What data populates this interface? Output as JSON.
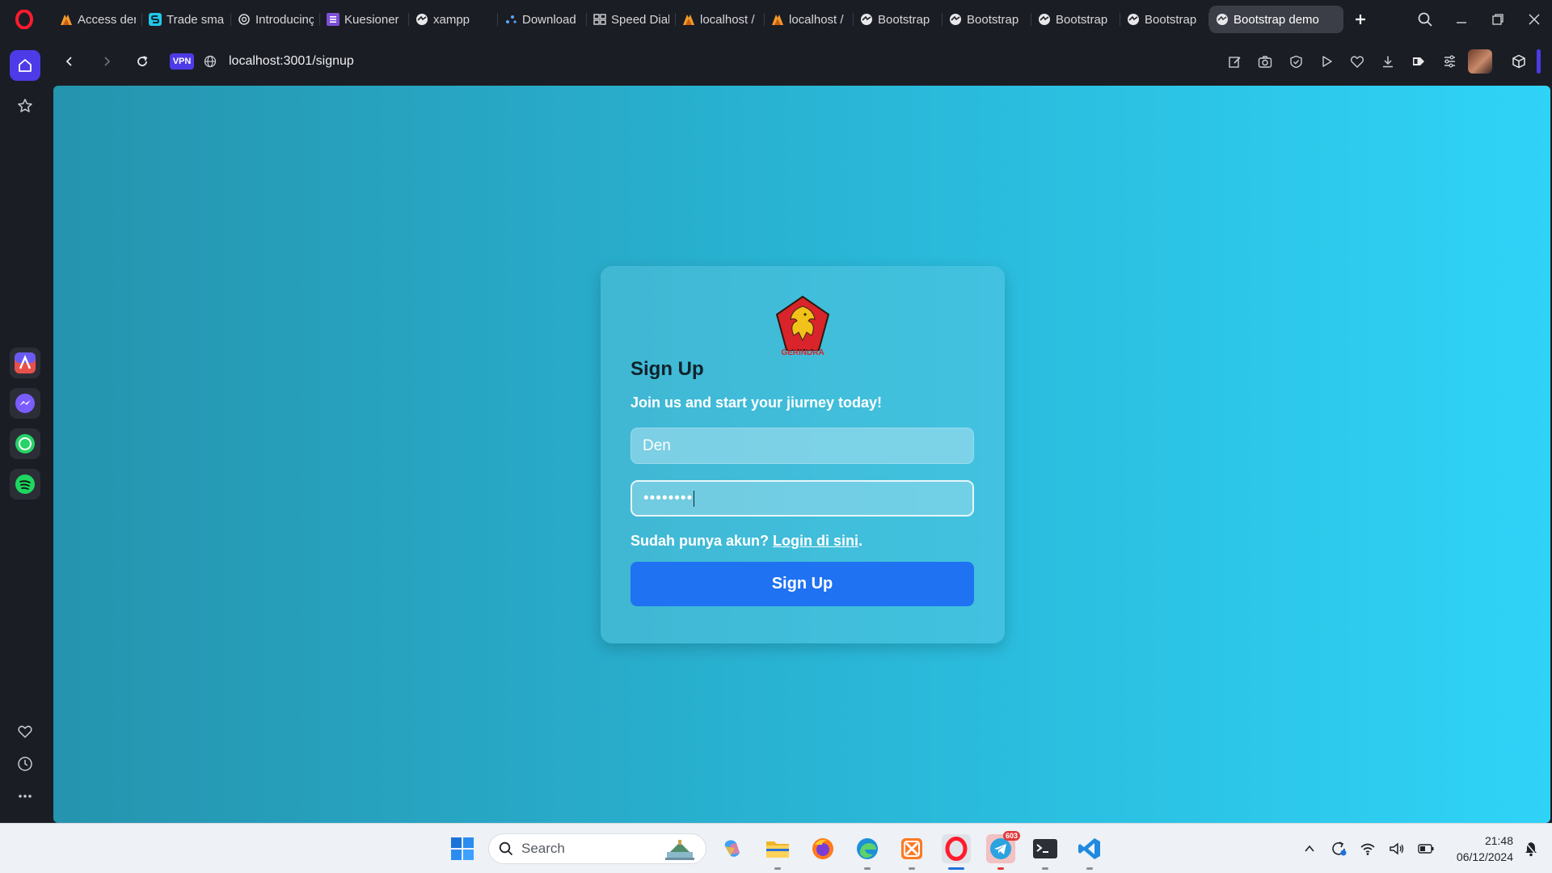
{
  "browser": {
    "tabs": [
      {
        "title": "Access den",
        "icon": "xampp-icon"
      },
      {
        "title": "Trade smar",
        "icon": "swap-app-icon"
      },
      {
        "title": "Introducinç",
        "icon": "openai-icon"
      },
      {
        "title": "Kuesioner",
        "icon": "forms-icon"
      },
      {
        "title": "xampp",
        "icon": "globe-icon"
      },
      {
        "title": "Download",
        "icon": "download-icon"
      },
      {
        "title": "Speed Dial",
        "icon": "speed-dial-icon"
      },
      {
        "title": "localhost /",
        "icon": "phpmyadmin-icon"
      },
      {
        "title": "localhost /",
        "icon": "phpmyadmin-icon"
      },
      {
        "title": "Bootstrap",
        "icon": "globe-icon"
      },
      {
        "title": "Bootstrap",
        "icon": "globe-icon"
      },
      {
        "title": "Bootstrap",
        "icon": "globe-icon"
      },
      {
        "title": "Bootstrap",
        "icon": "globe-icon"
      },
      {
        "title": "Bootstrap demo",
        "icon": "globe-icon",
        "active": true
      }
    ],
    "vpn_label": "VPN",
    "url": "localhost:3001/signup",
    "accent": "#4d3be8"
  },
  "page": {
    "logo_text": "GERINDRA",
    "title": "Sign Up",
    "subtitle": "Join us and start your jiurney today!",
    "name_value": "Den",
    "password_mask": "••••••••",
    "login_prompt": "Sudah punya akun?",
    "login_link": "Login di sini",
    "login_suffix": ".",
    "submit_label": "Sign Up",
    "colors": {
      "gradient_start": "#2594ae",
      "gradient_end": "#2fd3f7",
      "button": "#1f72f2"
    }
  },
  "taskbar": {
    "search_label": "Search",
    "time": "21:48",
    "date": "06/12/2024",
    "telegram_badge": "603"
  }
}
